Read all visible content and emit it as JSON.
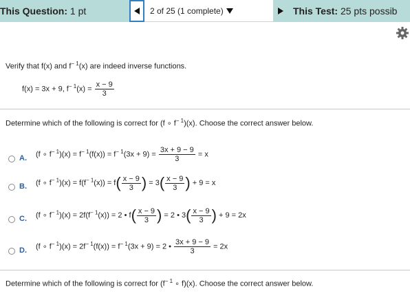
{
  "header": {
    "question_label": "This Question:",
    "question_points": "1 pt",
    "progress": "2 of 25 (1 complete)",
    "test_label": "This Test:",
    "test_points": "25 pts possib"
  },
  "icons": {
    "prev": "triangle-left-icon",
    "dropdown": "triangle-down-icon",
    "next": "triangle-right-icon",
    "settings": "gear-icon"
  },
  "colors": {
    "topbar": "#b7dbd8",
    "accent": "#2f7fc4",
    "option_letter": "#2b5fa0"
  },
  "prompt": {
    "line1a": "Verify that f(x) and f",
    "line1sup": "− 1",
    "line1b": "(x) are indeed inverse functions.",
    "defs_a": "f(x) = 3x + 9, f",
    "defs_sup": "− 1",
    "defs_b": "(x) = ",
    "defs_num": "x − 9",
    "defs_den": "3"
  },
  "question1": "Determine which of the following is correct for (f ∘ f",
  "question1_sup": "− 1",
  "question1_end": ")(x). Choose the correct answer below.",
  "options": {
    "A": {
      "letter": "A.",
      "parts": [
        "(f ∘ f",
        "− 1",
        ")(x) = f",
        "− 1",
        "(f(x)) = f",
        "− 1",
        "(3x + 9) = "
      ],
      "num": "3x + 9 − 9",
      "den": "3",
      "tail": " = x"
    },
    "B": {
      "letter": "B.",
      "parts": [
        "(f ∘ f",
        "− 1",
        ")(x) = f(f",
        "− 1",
        "(x)) = f"
      ],
      "num1": "x − 9",
      "den1": "3",
      "mid": " = 3",
      "num2": "x − 9",
      "den2": "3",
      "tail": " + 9 = x"
    },
    "C": {
      "letter": "C.",
      "parts": [
        "(f ∘ f",
        "− 1",
        ")(x) = 2f(f",
        "− 1",
        "(x)) = 2 • f"
      ],
      "num1": "x − 9",
      "den1": "3",
      "mid": " = 2 • 3",
      "num2": "x − 9",
      "den2": "3",
      "tail": " + 9 = 2x"
    },
    "D": {
      "letter": "D.",
      "parts": [
        "(f ∘ f",
        "− 1",
        ")(x) = 2f",
        "− 1",
        "(f(x)) = f",
        "− 1",
        "(3x + 9) = 2 • "
      ],
      "num": "3x + 9 − 9",
      "den": "3",
      "tail": " = 2x"
    }
  },
  "question2": "Determine which of the following is correct for (f",
  "question2_sup": "− 1",
  "question2_end": " ∘ f)(x). Choose the correct answer below."
}
